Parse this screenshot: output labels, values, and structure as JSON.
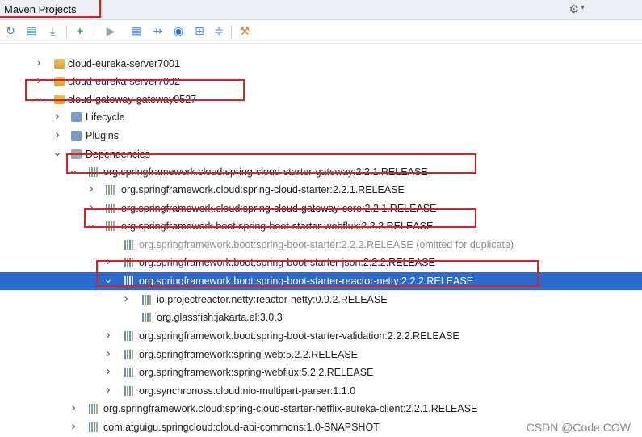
{
  "panel": {
    "title": "Maven Projects"
  },
  "toolbar": {
    "buttons": [
      "reimport-icon",
      "generate-sources-icon",
      "download-icon",
      "add-icon",
      "run-icon",
      "toggle-offline-icon",
      "skip-tests-icon",
      "lifecycle-icon",
      "show-dependencies-icon",
      "collapse-all-icon",
      "settings-icon"
    ]
  },
  "tree": [
    {
      "label": "cloud-eureka-server7001",
      "expanded": false,
      "icon": "module-icon"
    },
    {
      "label": "cloud-eureka-server7002",
      "expanded": false,
      "icon": "module-icon"
    },
    {
      "label": "cloud-gateway-gateway9527",
      "expanded": true,
      "icon": "module-icon"
    },
    {
      "label": "Lifecycle",
      "expanded": false,
      "icon": "folder-icon"
    },
    {
      "label": "Plugins",
      "expanded": false,
      "icon": "folder-icon"
    },
    {
      "label": "Dependencies",
      "expanded": true,
      "icon": "dependencies-icon"
    },
    {
      "label": "org.springframework.cloud:spring-cloud-starter-gateway:2.2.1.RELEASE",
      "expanded": true,
      "icon": "library-icon"
    },
    {
      "label": "org.springframework.cloud:spring-cloud-starter:2.2.1.RELEASE",
      "expanded": false,
      "icon": "library-icon"
    },
    {
      "label": "org.springframework.cloud:spring-cloud-gateway-core:2.2.1.RELEASE",
      "expanded": false,
      "icon": "library-icon"
    },
    {
      "label": "org.springframework.boot:spring-boot-starter-webflux:2.2.2.RELEASE",
      "expanded": true,
      "icon": "library-icon"
    },
    {
      "label": "org.springframework.boot:spring-boot-starter:2.2.2.RELEASE (omitted for duplicate)",
      "expanded": null,
      "icon": "library-icon"
    },
    {
      "label": "org.springframework.boot:spring-boot-starter-json:2.2.2.RELEASE",
      "expanded": false,
      "icon": "library-icon"
    },
    {
      "label": "org.springframework.boot:spring-boot-starter-reactor-netty:2.2.2.RELEASE",
      "expanded": true,
      "icon": "library-icon",
      "selected": true
    },
    {
      "label": "io.projectreactor.netty:reactor-netty:0.9.2.RELEASE",
      "expanded": false,
      "icon": "library-icon"
    },
    {
      "label": "org.glassfish:jakarta.el:3.0.3",
      "expanded": null,
      "icon": "library-icon"
    },
    {
      "label": "org.springframework.boot:spring-boot-starter-validation:2.2.2.RELEASE",
      "expanded": false,
      "icon": "library-icon"
    },
    {
      "label": "org.springframework:spring-web:5.2.2.RELEASE",
      "expanded": false,
      "icon": "library-icon"
    },
    {
      "label": "org.springframework:spring-webflux:5.2.2.RELEASE",
      "expanded": false,
      "icon": "library-icon"
    },
    {
      "label": "org.synchronoss.cloud:nio-multipart-parser:1.1.0",
      "expanded": false,
      "icon": "library-icon"
    },
    {
      "label": "org.springframework.cloud:spring-cloud-starter-netflix-eureka-client:2.2.1.RELEASE",
      "expanded": false,
      "icon": "library-icon"
    },
    {
      "label": "com.atguigu.springcloud:cloud-api-commons:1.0-SNAPSHOT",
      "expanded": false,
      "icon": "library-icon"
    }
  ],
  "watermark": "CSDN @Code.COW",
  "colors": {
    "selection": "#2b6ad1",
    "highlight_box": "#e02020"
  }
}
